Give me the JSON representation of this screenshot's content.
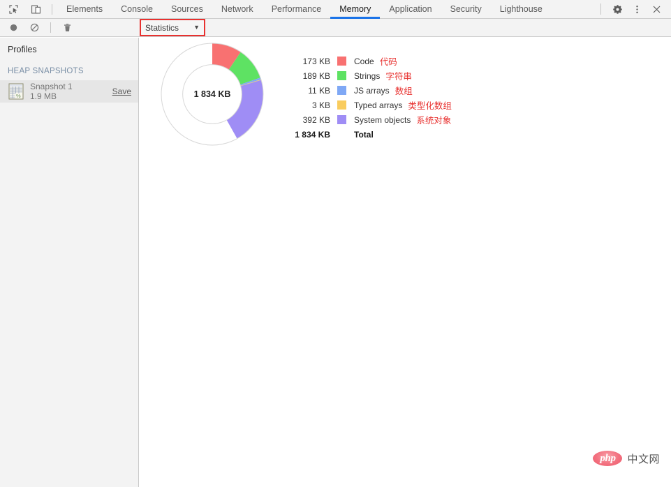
{
  "window": {
    "tabbar_icons": [
      {
        "name": "inspect-element-icon",
        "title": "Inspect element"
      },
      {
        "name": "device-toolbar-icon",
        "title": "Toggle device toolbar"
      }
    ],
    "tabs": [
      {
        "label": "Elements",
        "active": false
      },
      {
        "label": "Console",
        "active": false
      },
      {
        "label": "Sources",
        "active": false
      },
      {
        "label": "Network",
        "active": false
      },
      {
        "label": "Performance",
        "active": false
      },
      {
        "label": "Memory",
        "active": true
      },
      {
        "label": "Application",
        "active": false
      },
      {
        "label": "Security",
        "active": false
      },
      {
        "label": "Lighthouse",
        "active": false
      }
    ],
    "right_icons": [
      {
        "name": "gear-icon",
        "title": "Settings"
      },
      {
        "name": "more-vertical-icon",
        "title": "Customize and control DevTools"
      },
      {
        "name": "close-icon",
        "title": "Close DevTools"
      }
    ],
    "active_tab_underline_color": "#1a73e8"
  },
  "toolbar": {
    "icons": [
      {
        "name": "record-icon",
        "title": "Start recording heap profile"
      },
      {
        "name": "clear-icon",
        "title": "Clear all profiles"
      },
      {
        "name": "trash-icon",
        "title": "Delete profile"
      }
    ],
    "view_select": {
      "value": "Statistics",
      "caret": "▼",
      "highlight_color": "#e8312f"
    }
  },
  "sidebar": {
    "title": "Profiles",
    "section_label": "HEAP SNAPSHOTS",
    "snapshot": {
      "icon": "snapshot-grid-icon",
      "name": "Snapshot 1",
      "size": "1.9 MB",
      "save_label": "Save"
    }
  },
  "chart_data": {
    "type": "pie",
    "title": "",
    "center_label": "1 834 KB",
    "total_label": "Total",
    "total_value": "1 834 KB",
    "total_kb": 1834,
    "units": "KB",
    "inner_radius_ratio": 0.58,
    "start_angle_deg": -90,
    "legend_position": "right",
    "grid": false,
    "remainder_kb": 1066,
    "categories": [
      "Code",
      "Strings",
      "JS arrays",
      "Typed arrays",
      "System objects"
    ],
    "values": [
      173,
      189,
      11,
      3,
      392
    ],
    "value_labels": [
      "173 KB",
      "189 KB",
      "11 KB",
      "3 KB",
      "392 KB"
    ],
    "colors": [
      "#f87171",
      "#5ee263",
      "#7fa8f5",
      "#f9cc5e",
      "#9f8df5"
    ],
    "annotations": [
      "代码",
      "字符串",
      "数组",
      "类型化数组",
      "系统对象"
    ],
    "annotation_color": "#e8312f",
    "ring_outline_color": "#d7d7d7",
    "slices": [
      {
        "label": "Code",
        "value_label": "173 KB",
        "value": 173,
        "color": "#f87171",
        "annotation": "代码"
      },
      {
        "label": "Strings",
        "value_label": "189 KB",
        "value": 189,
        "color": "#5ee263",
        "annotation": "字符串"
      },
      {
        "label": "JS arrays",
        "value_label": "11 KB",
        "value": 11,
        "color": "#7fa8f5",
        "annotation": "数组"
      },
      {
        "label": "Typed arrays",
        "value_label": "3 KB",
        "value": 3,
        "color": "#f9cc5e",
        "annotation": "类型化数组"
      },
      {
        "label": "System objects",
        "value_label": "392 KB",
        "value": 392,
        "color": "#9f8df5",
        "annotation": "系统对象"
      }
    ]
  },
  "watermark": {
    "logo_text": "php",
    "text": "中文网",
    "logo_color": "#ef5a6b"
  }
}
